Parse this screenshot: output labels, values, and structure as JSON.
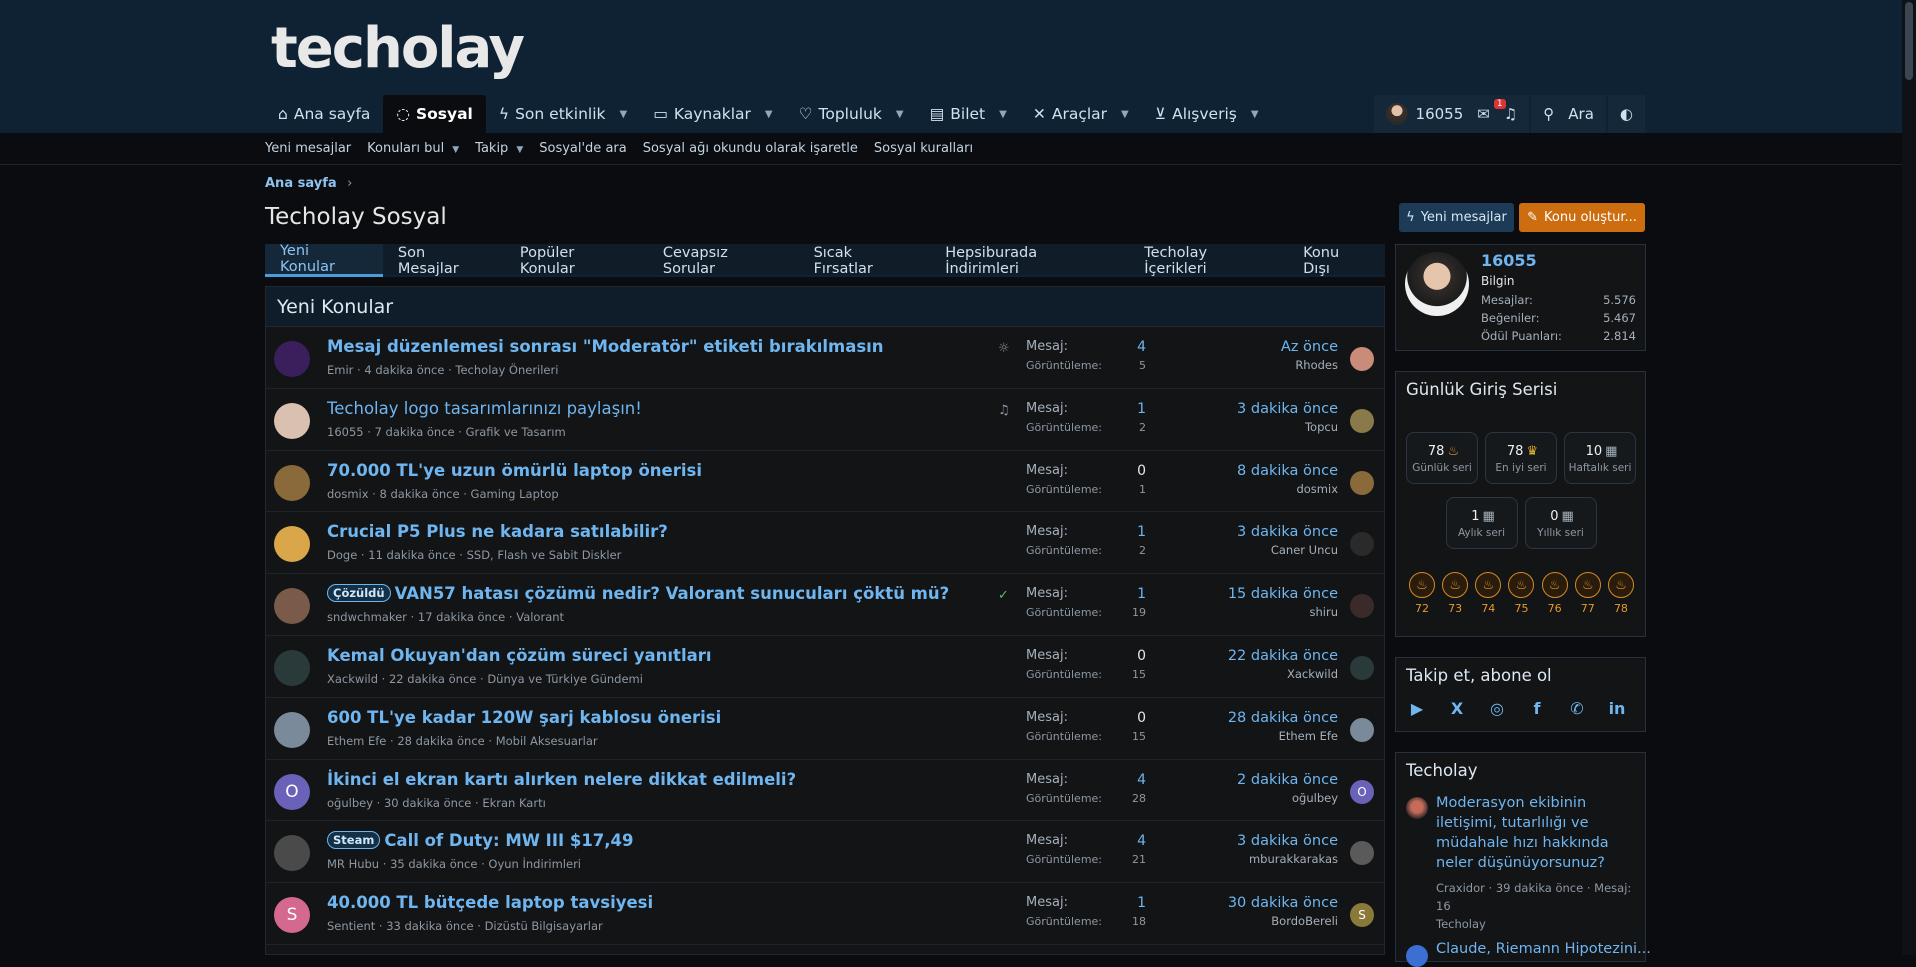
{
  "brand": {
    "logo": "techolay"
  },
  "nav": {
    "tabs": [
      {
        "label": "Ana sayfa",
        "icon": "home-icon"
      },
      {
        "label": "Sosyal",
        "icon": "chat-icon"
      },
      {
        "label": "Son etkinlik",
        "icon": "bolt-icon"
      },
      {
        "label": "Kaynaklar",
        "icon": "box-icon"
      },
      {
        "label": "Topluluk",
        "icon": "heart-icon"
      },
      {
        "label": "Bilet",
        "icon": "ticket-icon"
      },
      {
        "label": "Araçlar",
        "icon": "tools-icon"
      },
      {
        "label": "Alışveriş",
        "icon": "cart-icon"
      }
    ],
    "user_count": "16055",
    "alerts_badge": "1",
    "search_label": "Ara"
  },
  "subnav": [
    "Yeni mesajlar",
    "Konuları bul",
    "Takip",
    "Sosyal'de ara",
    "Sosyal ağı okundu olarak işaretle",
    "Sosyal kuralları"
  ],
  "breadcrumb": "Ana sayfa",
  "page_title": "Techolay Sosyal",
  "buttons": {
    "new_messages": "Yeni mesajlar",
    "create_thread": "Konu oluştur..."
  },
  "tabs": [
    "Yeni Konular",
    "Son Mesajlar",
    "Popüler Konular",
    "Cevapsız Sorular",
    "Sıcak Fırsatlar",
    "Hepsiburada İndirimleri",
    "Techolay İçerikleri",
    "Konu Dışı"
  ],
  "list_title": "Yeni Konular",
  "stats_labels": {
    "messages": "Mesaj:",
    "views": "Görüntüleme:"
  },
  "threads": [
    {
      "title": "Mesaj düzenlemesi sonrası \"Moderatör\" etiketi bırakılmasın",
      "author": "Emir",
      "time": "4 dakika önce",
      "forum": "Techolay Önerileri",
      "replies": "4",
      "views": "5",
      "last_time": "Az önce",
      "last_user": "Rhodes",
      "prefix": "",
      "avatar_color": "#3a1f5c",
      "last_color": "#c98c7a"
    },
    {
      "title": "Techolay logo tasarımlarınızı paylaşın!",
      "author": "16055",
      "time": "7 dakika önce",
      "forum": "Grafik ve Tasarım",
      "replies": "1",
      "views": "2",
      "last_time": "3 dakika önce",
      "last_user": "Topcu",
      "prefix": "",
      "avatar_color": "#d9c0b0",
      "last_color": "#8a7a4a"
    },
    {
      "title": "70.000 TL'ye uzun ömürlü laptop önerisi",
      "author": "dosmix",
      "time": "8 dakika önce",
      "forum": "Gaming Laptop",
      "replies": "0",
      "views": "1",
      "last_time": "8 dakika önce",
      "last_user": "dosmix",
      "prefix": "",
      "avatar_color": "#8a6a3a",
      "last_color": "#8a6a3a"
    },
    {
      "title": "Crucial P5 Plus ne kadara satılabilir?",
      "author": "Doge",
      "time": "11 dakika önce",
      "forum": "SSD, Flash ve Sabit Diskler",
      "replies": "1",
      "views": "2",
      "last_time": "3 dakika önce",
      "last_user": "Caner Uncu",
      "prefix": "",
      "avatar_color": "#d9a64a",
      "last_color": "#2a2a2a"
    },
    {
      "title": "VAN57 hatası çözümü nedir? Valorant sunucuları çöktü mü?",
      "author": "sndwchmaker",
      "time": "17 dakika önce",
      "forum": "Valorant",
      "replies": "1",
      "views": "19",
      "last_time": "15 dakika önce",
      "last_user": "shiru",
      "prefix": "Çözüldü",
      "avatar_color": "#7a5a4a",
      "last_color": "#3a2a2a"
    },
    {
      "title": "Kemal Okuyan'dan çözüm süreci yanıtları",
      "author": "Xackwild",
      "time": "22 dakika önce",
      "forum": "Dünya ve Türkiye Gündemi",
      "replies": "0",
      "views": "15",
      "last_time": "22 dakika önce",
      "last_user": "Xackwild",
      "prefix": "",
      "avatar_color": "#2a3a3a",
      "last_color": "#2a3a3a"
    },
    {
      "title": "600 TL'ye kadar 120W şarj kablosu önerisi",
      "author": "Ethem Efe",
      "time": "28 dakika önce",
      "forum": "Mobil Aksesuarlar",
      "replies": "0",
      "views": "15",
      "last_time": "28 dakika önce",
      "last_user": "Ethem Efe",
      "prefix": "",
      "avatar_color": "#7a8a9a",
      "last_color": "#7a8a9a"
    },
    {
      "title": "İkinci el ekran kartı alırken nelere dikkat edilmeli?",
      "author": "oğulbey",
      "time": "30 dakika önce",
      "forum": "Ekran Kartı",
      "replies": "4",
      "views": "28",
      "last_time": "2 dakika önce",
      "last_user": "oğulbey",
      "prefix": "",
      "avatar_color": "#6a62b8",
      "last_color": "#6a62b8",
      "letter": "O"
    },
    {
      "title": "Call of Duty: MW III $17,49",
      "author": "MR Hubu",
      "time": "35 dakika önce",
      "forum": "Oyun İndirimleri",
      "replies": "4",
      "views": "21",
      "last_time": "3 dakika önce",
      "last_user": "mburakkarakas",
      "prefix": "Steam",
      "avatar_color": "#4a4a4a",
      "last_color": "#5a5a5a"
    },
    {
      "title": "40.000 TL bütçede laptop tavsiyesi",
      "author": "Sentient",
      "time": "33 dakika önce",
      "forum": "Dizüstü Bilgisayarlar",
      "replies": "1",
      "views": "18",
      "last_time": "30 dakika önce",
      "last_user": "BordoBereli",
      "prefix": "",
      "avatar_color": "#d4688f",
      "last_color": "#8a7a3a",
      "letter": "S"
    }
  ],
  "profile": {
    "username": "16055",
    "rank": "Bilgin",
    "stats": [
      {
        "label": "Mesajlar:",
        "value": "5.576"
      },
      {
        "label": "Beğeniler:",
        "value": "5.467"
      },
      {
        "label": "Ödül Puanları:",
        "value": "2.814"
      }
    ]
  },
  "streak": {
    "title": "Günlük Giriş Serisi",
    "chips_row1": [
      {
        "value": "78",
        "label": "Günlük seri",
        "icon": "flame-icon"
      },
      {
        "value": "78",
        "label": "En iyi seri",
        "icon": "crown-icon"
      },
      {
        "value": "10",
        "label": "Haftalık seri",
        "icon": "calendar-icon"
      }
    ],
    "chips_row2": [
      {
        "value": "1",
        "label": "Aylık seri",
        "icon": "calendar-icon"
      },
      {
        "value": "0",
        "label": "Yıllık seri",
        "icon": "calendar-icon"
      }
    ],
    "days": [
      "72",
      "73",
      "74",
      "75",
      "76",
      "77",
      "78"
    ]
  },
  "follow": {
    "title": "Takip et, abone ol",
    "networks": [
      "youtube-icon",
      "x-icon",
      "instagram-icon",
      "facebook-icon",
      "whatsapp-icon",
      "linkedin-icon"
    ]
  },
  "techolay_box": {
    "title": "Techolay",
    "post_title": "Moderasyon ekibinin iletişimi, tutarlılığı ve müdahale hızı hakkında neler düşünüyorsunuz?",
    "post_meta": "Craxidor · 39 dakika önce · Mesaj: 16",
    "post_forum": "Techolay",
    "post2_title": "Claude, Riemann Hipotezini..."
  }
}
